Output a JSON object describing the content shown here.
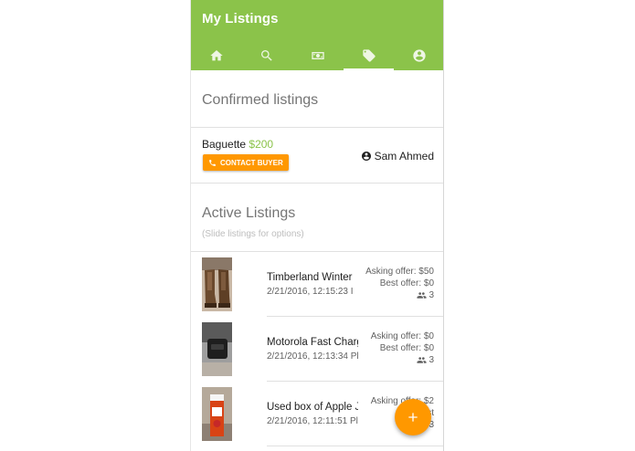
{
  "app": {
    "title": "My Listings"
  },
  "tabs": [
    {
      "icon": "home-icon",
      "active": false
    },
    {
      "icon": "search-icon",
      "active": false
    },
    {
      "icon": "money-icon",
      "active": false
    },
    {
      "icon": "tag-icon",
      "active": true
    },
    {
      "icon": "account-icon",
      "active": false
    }
  ],
  "confirmed": {
    "title": "Confirmed listings",
    "item": {
      "name": "Baguette",
      "price": "$200",
      "contact_label": "CONTACT BUYER",
      "buyer": "Sam Ahmed"
    }
  },
  "active": {
    "title": "Active Listings",
    "hint": "(Slide listings for options)",
    "items": [
      {
        "title": "Timberland Winter",
        "date": "2/21/2016, 12:15:23 I",
        "asking": "Asking offer: $50",
        "best": "Best offer: $0",
        "buyers": "3"
      },
      {
        "title": "Motorola Fast Charg",
        "date": "2/21/2016, 12:13:34 Pl",
        "asking": "Asking offer: $0",
        "best": "Best offer: $0",
        "buyers": "3"
      },
      {
        "title": "Used box of Apple J",
        "date": "2/21/2016, 12:11:51 Pl",
        "asking": "Asking offer: $2",
        "best": "Best",
        "buyers": "3"
      }
    ]
  },
  "colors": {
    "primary": "#8bc34a",
    "accent": "#ff9800"
  },
  "fab": {
    "icon": "plus-icon"
  }
}
